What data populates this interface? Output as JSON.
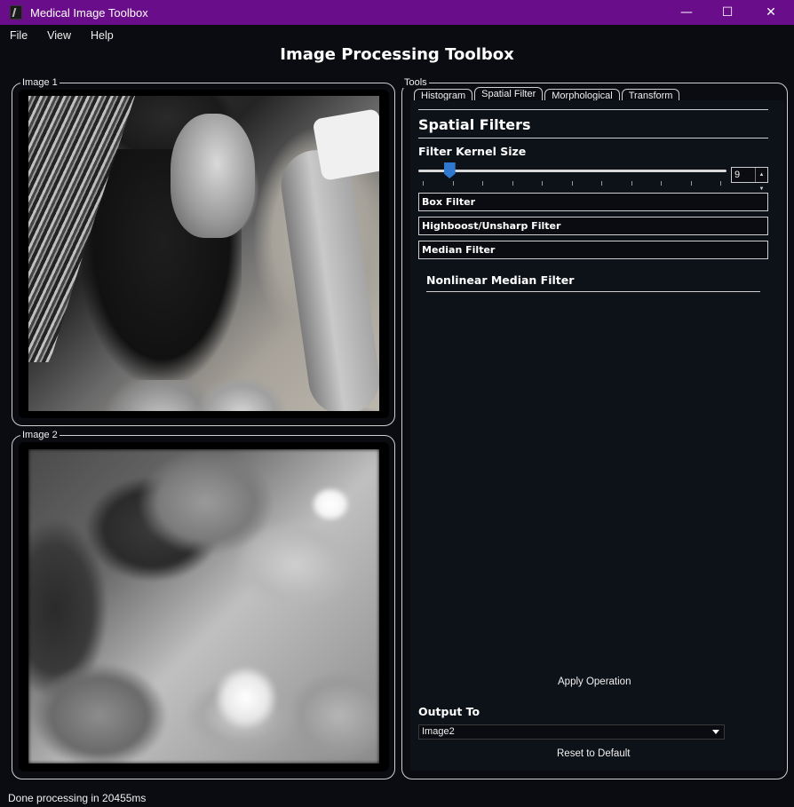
{
  "window": {
    "title": "Medical Image Toolbox",
    "minimize": "—",
    "maximize": "☐",
    "close": "✕",
    "titlebar_color": "#6a0d8a"
  },
  "menu": {
    "items": [
      "File",
      "View",
      "Help"
    ]
  },
  "app": {
    "heading": "Image Processing Toolbox"
  },
  "image1": {
    "label": "Image 1"
  },
  "image2": {
    "label": "Image 2"
  },
  "tools": {
    "label": "Tools",
    "tabs": [
      "Histogram",
      "Spatial Filter",
      "Morphological",
      "Transform"
    ],
    "active_tab": "Spatial Filter",
    "section_title": "Spatial Filters",
    "kernel_label": "Filter Kernel Size",
    "kernel_value": "9",
    "kernel_slider_fraction": 0.1,
    "buttons": {
      "box": "Box Filter",
      "highboost": "Highboost/Unsharp Filter",
      "median": "Median Filter"
    },
    "nonlinear_title": "Nonlinear Median Filter",
    "apply": "Apply Operation",
    "output_label": "Output To",
    "output_value": "Image2",
    "reset": "Reset to Default",
    "accent_color": "#2f78d0"
  },
  "status": {
    "text": "Done processing in 20455ms"
  }
}
